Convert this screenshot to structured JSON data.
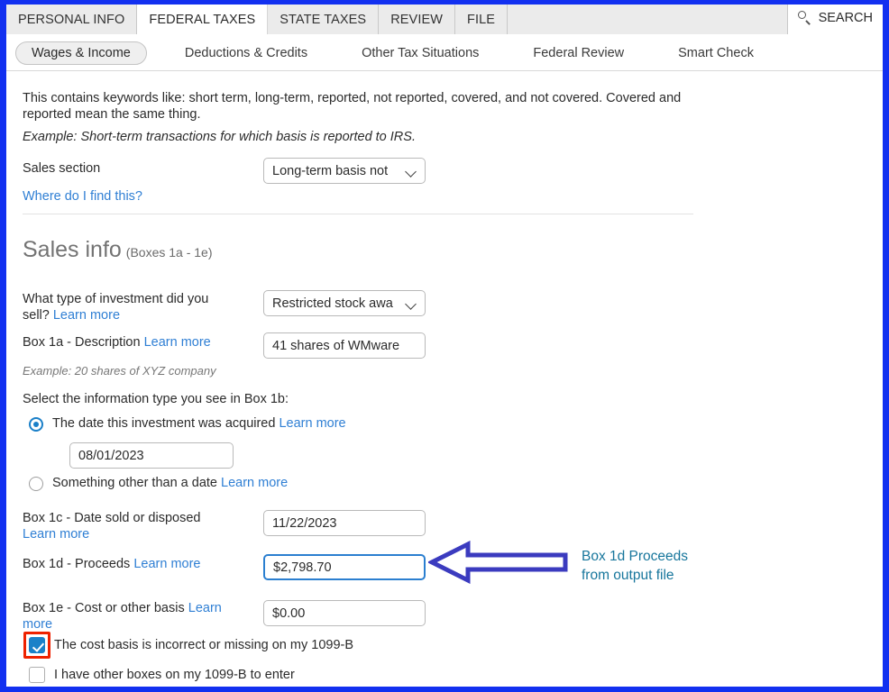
{
  "window": {
    "border_color": "#1230f0"
  },
  "top_tabs": [
    {
      "label": "PERSONAL INFO",
      "active": false
    },
    {
      "label": "FEDERAL TAXES",
      "active": true
    },
    {
      "label": "STATE TAXES",
      "active": false
    },
    {
      "label": "REVIEW",
      "active": false
    },
    {
      "label": "FILE",
      "active": false
    }
  ],
  "search": {
    "label": "SEARCH",
    "icon": "search-icon"
  },
  "sub_tabs": [
    {
      "label": "Wages & Income",
      "active": true
    },
    {
      "label": "Deductions & Credits",
      "active": false
    },
    {
      "label": "Other Tax Situations",
      "active": false
    },
    {
      "label": "Federal Review",
      "active": false
    },
    {
      "label": "Smart Check",
      "active": false
    }
  ],
  "intro": {
    "paragraph": "This contains keywords like: short term, long-term, reported, not reported, covered, and not covered. Covered and reported mean the same thing.",
    "example": "Example: Short-term transactions for which basis is reported to IRS."
  },
  "sales_section": {
    "label": "Sales section",
    "value": "Long-term basis not",
    "help_link": "Where do I find this?"
  },
  "sales_info": {
    "heading": "Sales info",
    "heading_sub": "(Boxes 1a - 1e)",
    "investment_type": {
      "label_line1": "What type of investment did you",
      "label_line2": "sell?",
      "learn_more": "Learn more",
      "value": "Restricted stock awa"
    },
    "box_1a": {
      "label": "Box 1a - Description",
      "learn_more": "Learn more",
      "value": "41 shares of WMware",
      "hint": "Example: 20 shares of XYZ company"
    },
    "box_1b": {
      "prompt": "Select the information type you see in Box 1b:",
      "option_date": {
        "label": "The date this investment was acquired",
        "learn_more": "Learn more",
        "selected": true,
        "value": "08/01/2023"
      },
      "option_other": {
        "label": "Something other than a date",
        "learn_more": "Learn more",
        "selected": false
      }
    },
    "box_1c": {
      "label_line1": "Box 1c - Date sold or disposed",
      "learn_more": "Learn more",
      "value": "11/22/2023"
    },
    "box_1d": {
      "label": "Box 1d - Proceeds",
      "learn_more": "Learn more",
      "value": "$2,798.70",
      "focused": true
    },
    "box_1e": {
      "label_line1": "Box 1e - Cost or other basis",
      "learn_more_line1": "Learn",
      "learn_more_line2": "more",
      "value": "$0.00"
    },
    "checkbox_cost_basis": {
      "label": "The cost basis is incorrect or missing on my 1099-B",
      "checked": true,
      "highlight_color": "#ee2200"
    },
    "checkbox_other_boxes": {
      "label": "I have other boxes on my 1099-B to enter",
      "checked": false
    }
  },
  "annotation": {
    "text": "Box 1d Proceeds\nfrom output file",
    "text_color": "#17769c",
    "arrow_color": "#3b3bbf",
    "arrow_direction": "left"
  }
}
